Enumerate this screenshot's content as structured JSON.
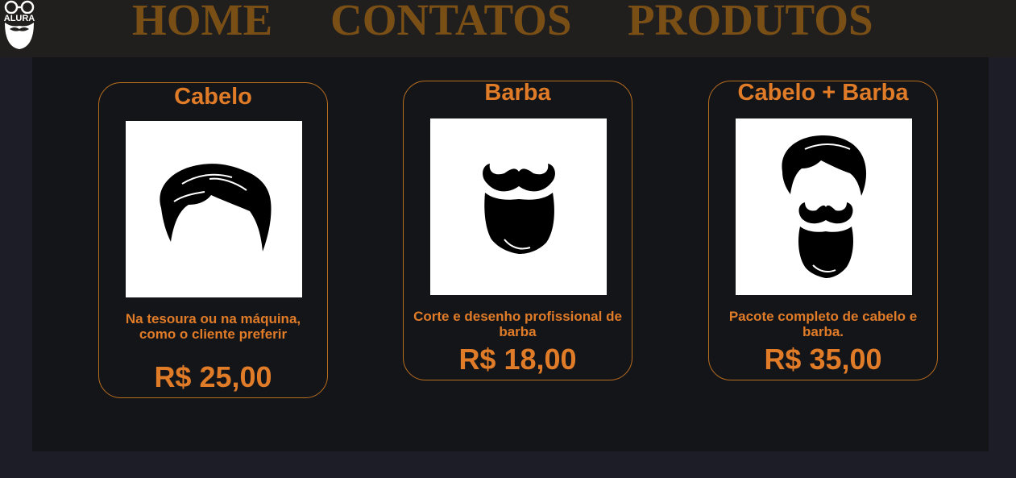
{
  "header": {
    "logo_text": "ALURA",
    "nav": [
      {
        "label": "HOME"
      },
      {
        "label": "CONTATOS"
      },
      {
        "label": "PRODUTOS"
      }
    ]
  },
  "products": [
    {
      "title": "Cabelo",
      "description": "Na tesoura ou na máquina, como o cliente preferir",
      "price": "R$ 25,00",
      "icon": "hair-icon"
    },
    {
      "title": "Barba",
      "description": "Corte e desenho profissional de barba",
      "price": "R$ 18,00",
      "icon": "beard-icon"
    },
    {
      "title": "Cabelo + Barba",
      "description": "Pacote completo de cabelo e barba.",
      "price": "R$ 35,00",
      "icon": "hair-and-beard-icon"
    }
  ],
  "colors": {
    "accent": "#e07b28",
    "nav_text": "#7a4f16",
    "header_bg": "#211f1e",
    "page_bg": "#1d1d27",
    "content_bg": "#141519",
    "card_border": "#b86d1f"
  }
}
